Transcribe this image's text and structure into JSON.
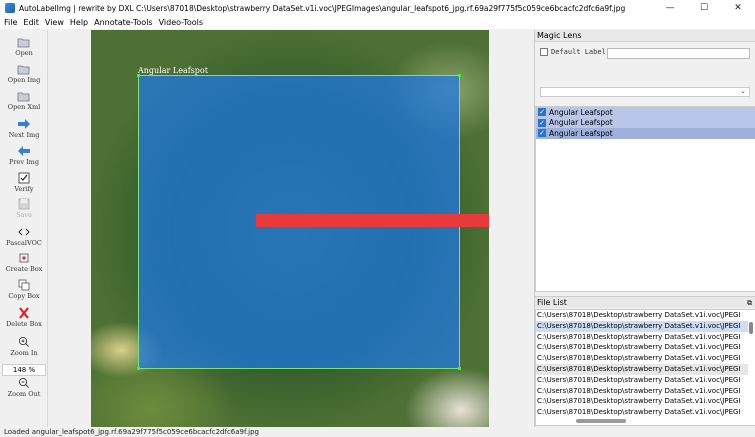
{
  "window": {
    "title": "AutoLabelImg | rewrite by DXL C:\\Users\\87018\\Desktop\\strawberry DataSet.v1i.voc\\JPEGImages\\angular_leafspot6_jpg.rf.69a29f775f5c059ce6bcacfc2dfc6a9f.jpg",
    "minimize": "—",
    "maximize": "☐",
    "close": "✕"
  },
  "menu": [
    "File",
    "Edit",
    "View",
    "Help",
    "Annotate-Tools",
    "Video-Tools"
  ],
  "toolbar": {
    "open": "Open",
    "open_img": "Open Img",
    "open_xml": "Open Xml",
    "next_img": "Next Img",
    "prev_img": "Prev Img",
    "verify": "Verify",
    "save": "Save",
    "format": "PascalVOC",
    "create_box": "Create Box",
    "copy_box": "Copy Box",
    "delete_box": "Delete Box",
    "zoom_in": "Zoom In",
    "zoom_value": "148 %",
    "zoom_out": "Zoom Out"
  },
  "canvas": {
    "box_label": "Angular Leafspot"
  },
  "magic_lens": {
    "title": "Magic Lens",
    "default_label": "Default Label",
    "default_label_value": "",
    "combo_value": ""
  },
  "labels": [
    "Angular Leafspot",
    "Angular Leafspot",
    "Angular Leafspot"
  ],
  "file_list": {
    "title": "File List",
    "items": [
      "C:\\Users\\87018\\Desktop\\strawberry DataSet.v1i.voc\\JPEGI",
      "C:\\Users\\87018\\Desktop\\strawberry DataSet.v1i.voc\\JPEGI",
      "C:\\Users\\87018\\Desktop\\strawberry DataSet.v1i.voc\\JPEGI",
      "C:\\Users\\87018\\Desktop\\strawberry DataSet.v1i.voc\\JPEGI",
      "C:\\Users\\87018\\Desktop\\strawberry DataSet.v1i.voc\\JPEGI",
      "C:\\Users\\87018\\Desktop\\strawberry DataSet.v1i.voc\\JPEGI",
      "C:\\Users\\87018\\Desktop\\strawberry DataSet.v1i.voc\\JPEGI",
      "C:\\Users\\87018\\Desktop\\strawberry DataSet.v1i.voc\\JPEGI",
      "C:\\Users\\87018\\Desktop\\strawberry DataSet.v1i.voc\\JPEGI",
      "C:\\Users\\87018\\Desktop\\strawberry DataSet.v1i.voc\\JPEGI"
    ]
  },
  "status": "Loaded angular_leafspot6_jpg.rf.69a29f775f5c059ce6bcacfc2dfc6a9f.jpg",
  "colors": {
    "box_fill": "#1e78e6",
    "box_border": "#7ee07e",
    "red_bar": "#e83a3a",
    "selection": "#b9c6e8"
  }
}
